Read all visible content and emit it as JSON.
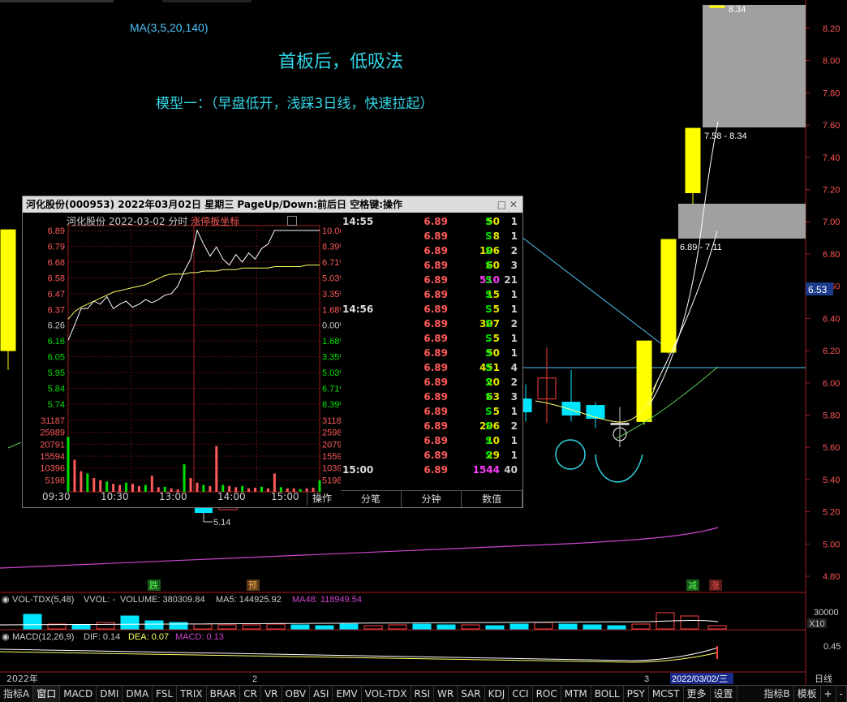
{
  "header": {
    "ma_label": "MA(3,5,20,140)",
    "title": "首板后，低吸法",
    "subtitle": "模型一：（早盘低开，浅踩3日线，快速拉起）"
  },
  "price_axis": {
    "labels": [
      "8.20",
      "8.00",
      "7.80",
      "7.60",
      "7.40",
      "7.20",
      "7.00",
      "6.80",
      "6.60",
      "6.40",
      "6.20",
      "6.00",
      "5.80",
      "5.60",
      "5.40",
      "5.20",
      "5.00",
      "4.80"
    ],
    "current": "6.53"
  },
  "annotations": {
    "high": "8.34",
    "low": "5.14",
    "zone1": "7.58 - 8.34",
    "zone2": "6.89 - 7.11",
    "tag_die": "跌",
    "tag_yu": "预",
    "tag_jian": "减",
    "tag_zhang": "涨"
  },
  "volume_panel": {
    "label": "VOL-TDX(5,48)",
    "vvol": "VVOL: -",
    "volume": "VOLUME: 380309.84",
    "ma5": "MA5: 144925.92",
    "ma48": "MA48: 118949.54",
    "axis_label": "30000",
    "axis_unit": "X10"
  },
  "macd_panel": {
    "label": "MACD(12,26,9)",
    "dif": "DIF: 0.14",
    "dea": "DEA: 0.07",
    "macd": "MACD: 0.13",
    "axis_label": "0.45"
  },
  "time_axis": {
    "year": "2022年",
    "m2": "2",
    "m3": "3",
    "current_date": "2022/03/02/三",
    "daily": "日线"
  },
  "toolbar": [
    "指标A",
    "窗口",
    "MACD",
    "DMI",
    "DMA",
    "FSL",
    "TRIX",
    "BRAR",
    "CR",
    "VR",
    "OBV",
    "ASI",
    "EMV",
    "VOL-TDX",
    "RSI",
    "WR",
    "SAR",
    "KDJ",
    "CCI",
    "ROC",
    "MTM",
    "BOLL",
    "PSY",
    "MCST",
    "更多",
    "设置"
  ],
  "toolbar_right": [
    "指标B",
    "模板",
    "+",
    "-"
  ],
  "popup": {
    "title": "河化股份(000953)  2022年03月02日 星期三 PageUp/Down:前后日 空格键:操作",
    "chart_title": "河化股份  2022-03-02 分时 ",
    "chart_title_red": "涨停板坐标",
    "op_button": "操作",
    "left_prices": [
      "6.89",
      "6.79",
      "6.68",
      "6.58",
      "6.47",
      "6.37",
      "6.26",
      "6.16",
      "6.05",
      "5.95",
      "5.84",
      "5.74"
    ],
    "right_pcts": [
      "10.06%",
      "8.39%",
      "6.71%",
      "5.03%",
      "3.35%",
      "1.68%",
      "0.00%",
      "1.68%",
      "3.35%",
      "5.03%",
      "6.71%",
      "8.39%"
    ],
    "vol_left": [
      "31187",
      "25989",
      "20791",
      "15594",
      "10396",
      "5198"
    ],
    "vol_right": [
      "31187",
      "25989",
      "20791",
      "15594",
      "10396",
      "5198"
    ],
    "x_labels": [
      "09:30",
      "10:30",
      "13:00",
      "14:00",
      "15:00"
    ],
    "ticks": [
      {
        "t": "14:55",
        "p": "6.89",
        "v": "50",
        "s": "S",
        "n": "1"
      },
      {
        "t": "",
        "p": "6.89",
        "v": "8",
        "s": "S",
        "n": "1"
      },
      {
        "t": "",
        "p": "6.89",
        "v": "106",
        "s": "S",
        "n": "2"
      },
      {
        "t": "",
        "p": "6.89",
        "v": "60",
        "s": "S",
        "n": "3"
      },
      {
        "t": "",
        "p": "6.89",
        "v": "510",
        "s": "S",
        "n": "21"
      },
      {
        "t": "",
        "p": "6.89",
        "v": "15",
        "s": "S",
        "n": "1"
      },
      {
        "t": "14:56",
        "p": "6.89",
        "v": "5",
        "s": "S",
        "n": "1"
      },
      {
        "t": "",
        "p": "6.89",
        "v": "307",
        "s": "S",
        "n": "2"
      },
      {
        "t": "",
        "p": "6.89",
        "v": "5",
        "s": "S",
        "n": "1"
      },
      {
        "t": "",
        "p": "6.89",
        "v": "50",
        "s": "S",
        "n": "1"
      },
      {
        "t": "",
        "p": "6.89",
        "v": "451",
        "s": "S",
        "n": "4"
      },
      {
        "t": "",
        "p": "6.89",
        "v": "20",
        "s": "S",
        "n": "2"
      },
      {
        "t": "",
        "p": "6.89",
        "v": "63",
        "s": "S",
        "n": "3"
      },
      {
        "t": "",
        "p": "6.89",
        "v": "5",
        "s": "S",
        "n": "1"
      },
      {
        "t": "",
        "p": "6.89",
        "v": "206",
        "s": "S",
        "n": "2"
      },
      {
        "t": "",
        "p": "6.89",
        "v": "10",
        "s": "S",
        "n": "1"
      },
      {
        "t": "",
        "p": "6.89",
        "v": "29",
        "s": "S",
        "n": "1"
      },
      {
        "t": "15:00",
        "p": "6.89",
        "v": "1544",
        "s": "",
        "n": "40"
      }
    ],
    "tabs": [
      "分笔",
      "分钟",
      "数值"
    ]
  },
  "chart_data": {
    "type": "candlestick",
    "yrange": [
      4.7,
      8.35
    ],
    "candles": [
      {
        "o": 6.2,
        "c": 6.95,
        "h": 6.95,
        "l": 6.08,
        "color": "#ffff00"
      },
      {
        "o": 5.82,
        "c": 5.9,
        "h": 5.99,
        "l": 5.76,
        "color": "#00e5ff"
      },
      {
        "o": 5.9,
        "c": 6.03,
        "h": 6.22,
        "l": 5.75,
        "color": "#ff4040"
      },
      {
        "o": 5.88,
        "c": 5.8,
        "h": 6.08,
        "l": 5.76,
        "color": "#00e5ff"
      },
      {
        "o": 5.86,
        "c": 5.78,
        "h": 5.88,
        "l": 5.72,
        "color": "#00e5ff"
      },
      {
        "o": 5.75,
        "c": 5.74,
        "h": 5.85,
        "l": 5.6,
        "color": "#cccccc"
      },
      {
        "o": 5.76,
        "c": 6.26,
        "h": 6.26,
        "l": 5.74,
        "color": "#ffff00"
      },
      {
        "o": 6.19,
        "c": 6.89,
        "h": 6.89,
        "l": 6.18,
        "color": "#ffff00"
      },
      {
        "o": 7.18,
        "c": 7.58,
        "h": 7.58,
        "l": 7.11,
        "color": "#ffff00"
      },
      {
        "o": 8.34,
        "c": 8.34,
        "h": 8.34,
        "l": 8.34,
        "color": "#ffff00"
      }
    ],
    "intraday_price": [
      6.16,
      6.26,
      6.37,
      6.37,
      6.42,
      6.4,
      6.45,
      6.37,
      6.4,
      6.42,
      6.38,
      6.4,
      6.43,
      6.41,
      6.43,
      6.46,
      6.47,
      6.52,
      6.62,
      6.7,
      6.89,
      6.8,
      6.72,
      6.78,
      6.7,
      6.66,
      6.73,
      6.68,
      6.74,
      6.7,
      6.77,
      6.8,
      6.89,
      6.89,
      6.89,
      6.89,
      6.89,
      6.89,
      6.89,
      6.89
    ],
    "intraday_avg": [
      6.3,
      6.35,
      6.38,
      6.4,
      6.42,
      6.44,
      6.46,
      6.48,
      6.49,
      6.5,
      6.51,
      6.52,
      6.53,
      6.55,
      6.57,
      6.59,
      6.6,
      6.6,
      6.6,
      6.61,
      6.61,
      6.62,
      6.62,
      6.62,
      6.63,
      6.63,
      6.63,
      6.64,
      6.64,
      6.64,
      6.64,
      6.64,
      6.65,
      6.65,
      6.65,
      6.65,
      6.65,
      6.66,
      6.66,
      6.66
    ],
    "intraday_volume": [
      24000,
      14000,
      9000,
      8000,
      6000,
      5000,
      4500,
      3500,
      3000,
      4000,
      3500,
      2500,
      3000,
      7000,
      2000,
      2200,
      1500,
      1000,
      12000,
      6000,
      4000,
      3000,
      2500,
      20000,
      3000,
      2500,
      2000,
      2500,
      1500,
      1800,
      2200,
      1500,
      8000,
      2000,
      1500,
      1500,
      1200,
      1500,
      1800,
      5000
    ]
  }
}
